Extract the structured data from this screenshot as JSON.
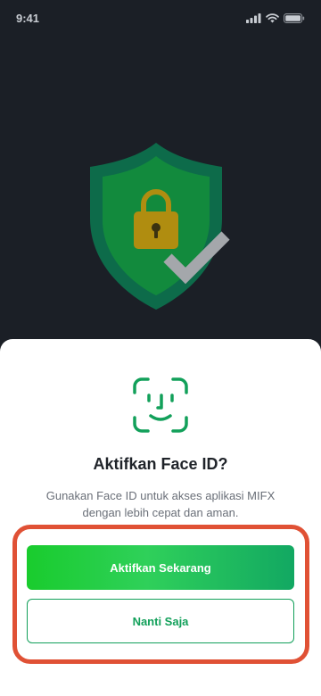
{
  "status_bar": {
    "time": "9:41",
    "icons": [
      "signal-icon",
      "wifi-icon",
      "battery-icon"
    ]
  },
  "hero": {
    "icons": [
      "shield-icon",
      "padlock-icon",
      "checkmark-icon"
    ]
  },
  "sheet": {
    "icon": "face-id-icon",
    "title": "Aktifkan Face ID?",
    "description": "Gunakan Face ID untuk akses aplikasi MIFX dengan lebih cepat dan aman.",
    "primary_button": "Aktifkan Sekarang",
    "secondary_button": "Nanti Saja"
  },
  "colors": {
    "background": "#1b1f26",
    "accent_green": "#12a05a",
    "highlight_frame": "#e05135",
    "shield_outer": "#0d6b4a",
    "shield_inner": "#128a3d",
    "padlock": "#b08d10"
  }
}
